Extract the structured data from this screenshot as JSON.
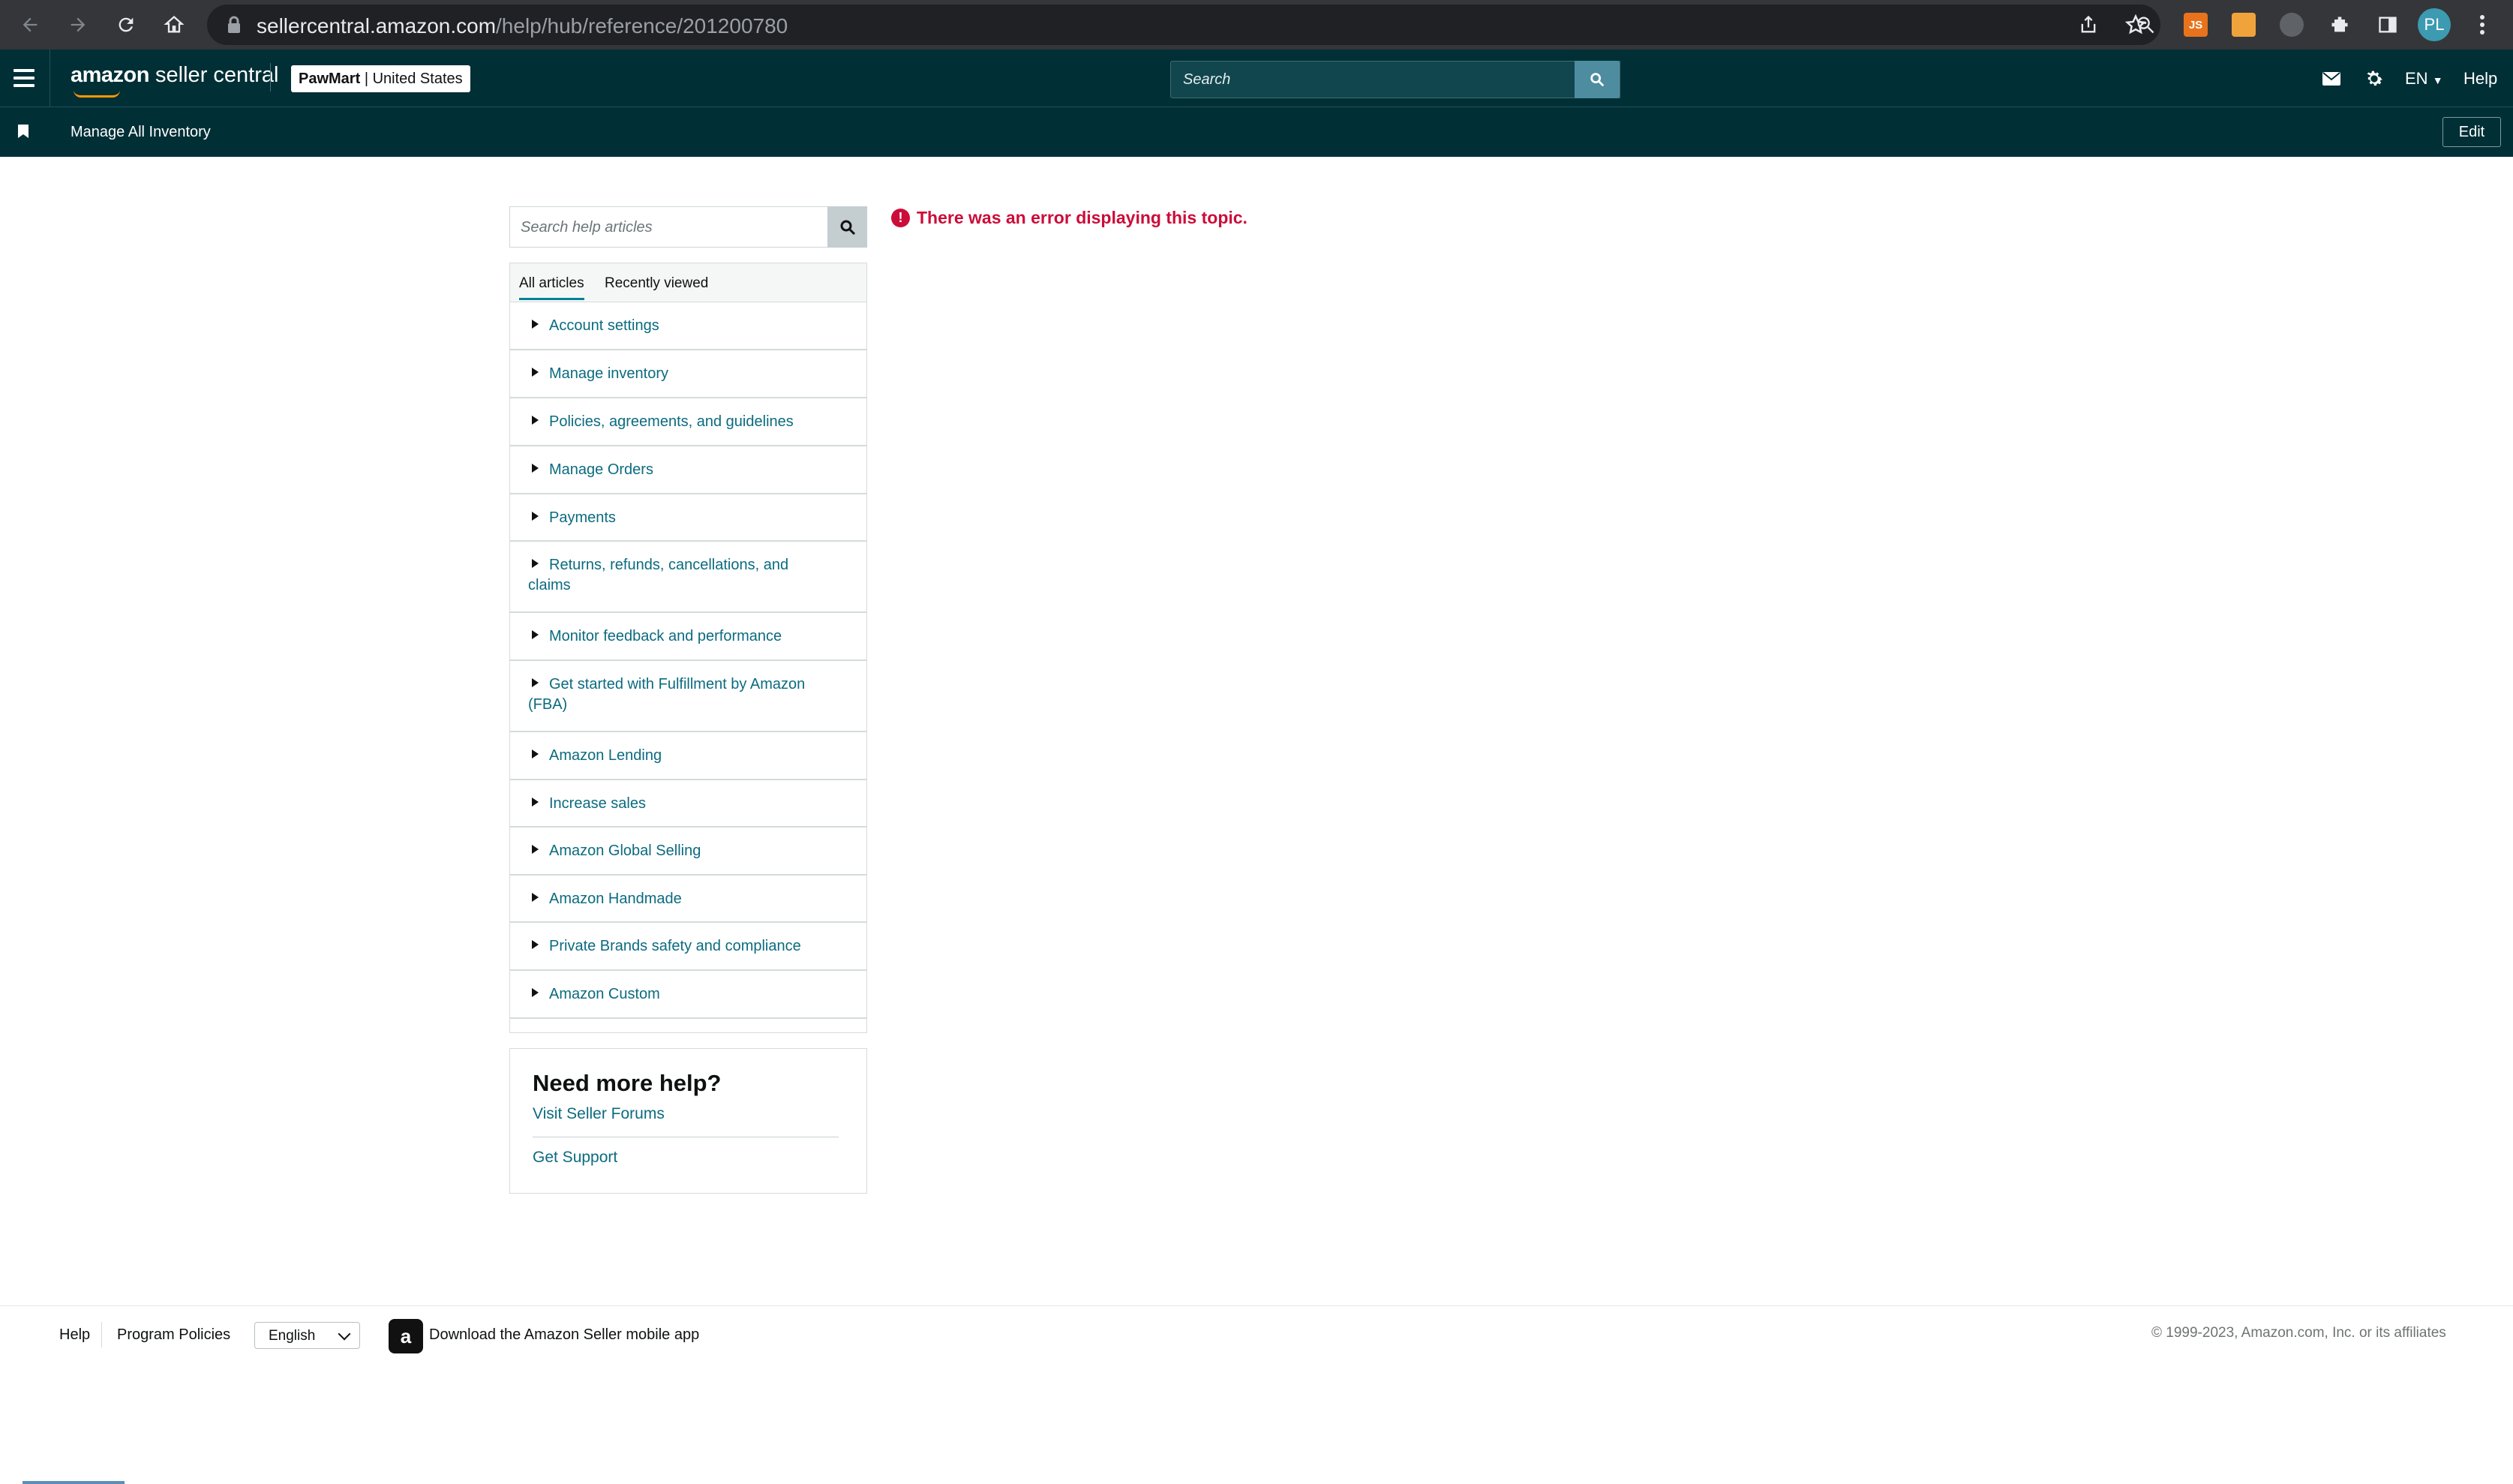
{
  "browser": {
    "url_host": "sellercentral.amazon.com",
    "url_path": "/help/hub/reference/201200780",
    "profile_initials": "PL",
    "extensions": [
      {
        "name": "js-extension-icon",
        "label": "JS",
        "color": "#e8731c"
      },
      {
        "name": "image-extension-icon",
        "label": "",
        "color": "#f1a33b"
      },
      {
        "name": "tools-extension-icon",
        "label": "",
        "color": "#9aa0a6"
      }
    ]
  },
  "header": {
    "logo_amazon": "amazon",
    "logo_product": "seller central",
    "store_name": "PawMart",
    "store_region": "| United States",
    "search_placeholder": "Search",
    "language": "EN",
    "help_label": "Help",
    "brand_dark": "#002f36",
    "accent": "#008296"
  },
  "subheader": {
    "bookmark_label": "Manage All Inventory",
    "edit_label": "Edit"
  },
  "help_search": {
    "placeholder": "Search help articles"
  },
  "tabs": [
    "All articles",
    "Recently viewed"
  ],
  "nav_items": [
    {
      "label": "Account settings"
    },
    {
      "label": "Manage inventory"
    },
    {
      "label": "Policies, agreements, and guidelines"
    },
    {
      "label": "Manage Orders"
    },
    {
      "label": "Payments"
    },
    {
      "label": "Returns, refunds, cancellations, and",
      "label2": "claims"
    },
    {
      "label": "Monitor feedback and performance"
    },
    {
      "label": "Get started with Fulfillment by Amazon",
      "label2": "(FBA)"
    },
    {
      "label": "Amazon Lending"
    },
    {
      "label": "Increase sales"
    },
    {
      "label": "Amazon Global Selling"
    },
    {
      "label": "Amazon Handmade"
    },
    {
      "label": "Private Brands safety and compliance"
    },
    {
      "label": "Amazon Custom"
    }
  ],
  "more_help": {
    "title": "Need more help?",
    "link_forums": "Visit Seller Forums",
    "link_support": "Get Support"
  },
  "error": {
    "message": "There was an error displaying this topic.",
    "color": "#cc0c39"
  },
  "footer": {
    "help": "Help",
    "program_policies": "Program Policies",
    "language_selected": "English",
    "app_text": "Download the Amazon Seller mobile app",
    "copyright": "© 1999-2023, Amazon.com, Inc. or its affiliates"
  }
}
